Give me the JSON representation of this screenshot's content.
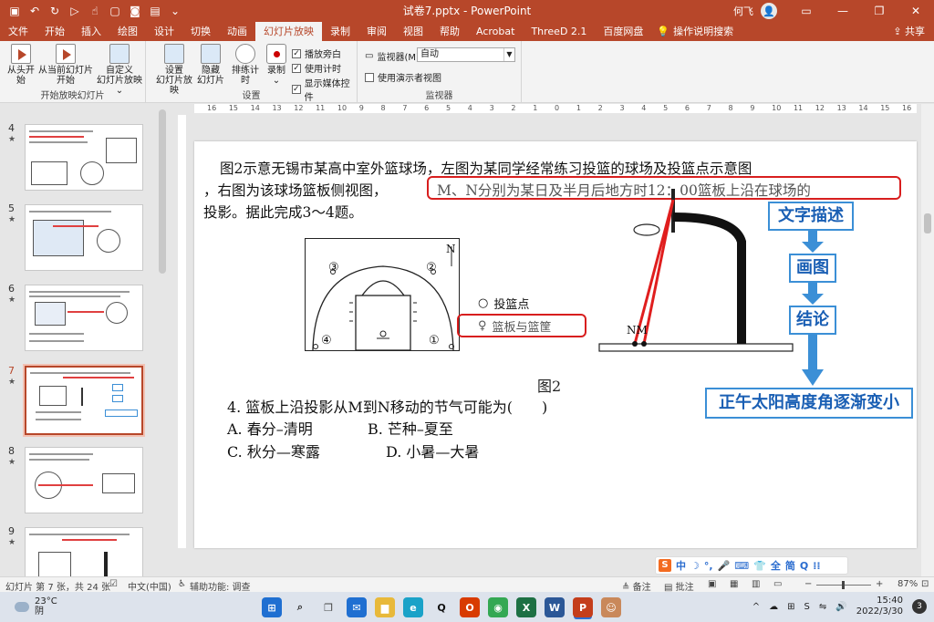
{
  "window": {
    "title": "试卷7.pptx - PowerPoint",
    "user": "何飞",
    "avatar": "👤"
  },
  "tabs": [
    {
      "label": "文件"
    },
    {
      "label": "开始"
    },
    {
      "label": "插入"
    },
    {
      "label": "绘图"
    },
    {
      "label": "设计"
    },
    {
      "label": "切换"
    },
    {
      "label": "动画"
    },
    {
      "label": "幻灯片放映"
    },
    {
      "label": "录制"
    },
    {
      "label": "审阅"
    },
    {
      "label": "视图"
    },
    {
      "label": "帮助"
    },
    {
      "label": "Acrobat"
    },
    {
      "label": "ThreeD 2.1"
    },
    {
      "label": "百度网盘"
    }
  ],
  "active_tab": "幻灯片放映",
  "tell_me": "操作说明搜索",
  "share": "共享",
  "ribbon": {
    "from_beginning": "从头开始",
    "from_current_1": "从当前幻灯片",
    "from_current_2": "开始",
    "custom_1": "自定义",
    "custom_2": "幻灯片放映 ⌄",
    "group_start": "开始放映幻灯片",
    "setup_1": "设置",
    "setup_2": "幻灯片放映",
    "hide_1": "隐藏",
    "hide_2": "幻灯片",
    "rehearse": "排练计时",
    "record": "录制",
    "record_arrow": "⌄",
    "play_narrations": "播放旁白",
    "use_timings": "使用计时",
    "show_media": "显示媒体控件",
    "group_setup": "设置",
    "monitor_label": "监视器(M):",
    "monitor_value": "自动",
    "presenter_view": "使用演示者视图",
    "group_monitor": "监视器"
  },
  "thumbnails": [
    {
      "num": "4"
    },
    {
      "num": "5"
    },
    {
      "num": "6"
    },
    {
      "num": "7"
    },
    {
      "num": "8"
    },
    {
      "num": "9"
    }
  ],
  "slide": {
    "line1": "图2示意无锡市某高中室外篮球场，左图为某同学经常练习投篮的球场及投篮点示意图",
    "line2a": "，右图为该球场篮板侧视图，",
    "line2b": "M、N分别为某日及半月后地方时12：00篮板上沿在球场的",
    "line3": "投影。据此完成3～4题。",
    "court_marks": [
      "③",
      "②",
      "④",
      "①"
    ],
    "north": "N",
    "legend_point": "投篮点",
    "legend_board": "篮板与篮筐",
    "nm_label": "NM",
    "flow1": "文字描述",
    "flow2": "画图",
    "flow3": "结论",
    "flow4": "正午太阳高度角逐渐变小",
    "fig_label": "图2",
    "question": "4. 篮板上沿投影从M到N移动的节气可能为(　　)",
    "optA": "A. 春分–清明",
    "optB": "B. 芒种–夏至",
    "optC": "C. 秋分—寒露",
    "optD": "D. 小暑—大暑"
  },
  "ruler_ticks": [
    "16",
    "15",
    "14",
    "13",
    "12",
    "11",
    "10",
    "9",
    "8",
    "7",
    "6",
    "5",
    "4",
    "3",
    "2",
    "1",
    "0",
    "1",
    "2",
    "3",
    "4",
    "5",
    "6",
    "7",
    "8",
    "9",
    "10",
    "11",
    "12",
    "13",
    "14",
    "15",
    "16"
  ],
  "statusbar": {
    "slide_info": "幻灯片 第 7 张，共 24 张",
    "language": "中文(中国)",
    "accessibility": "辅助功能: 调查",
    "notes": "备注",
    "comments": "批注",
    "zoom": "87%"
  },
  "ime": {
    "items": [
      "中",
      "☽",
      "°,",
      "🎤",
      "⌨",
      "👕",
      "全",
      "简",
      "Q",
      "⁞⁞"
    ]
  },
  "taskbar": {
    "temp": "23°C",
    "weather": "阴",
    "time": "15:40",
    "date": "2022/3/30",
    "notif_count": "3",
    "apps": [
      {
        "name": "start",
        "glyph": "⊞",
        "color": "#1f6fd1"
      },
      {
        "name": "search",
        "glyph": "⌕",
        "color": "#333333"
      },
      {
        "name": "taskview",
        "glyph": "❐",
        "color": "#444444"
      },
      {
        "name": "mail",
        "glyph": "✉",
        "color": "#1f6fd1"
      },
      {
        "name": "explorer",
        "glyph": "▆",
        "color": "#e8b93a"
      },
      {
        "name": "edge",
        "glyph": "e",
        "color": "#1aa2c8"
      },
      {
        "name": "qq",
        "glyph": "Q",
        "color": "#111111"
      },
      {
        "name": "office",
        "glyph": "O",
        "color": "#d83b01"
      },
      {
        "name": "chrome",
        "glyph": "◉",
        "color": "#34a853"
      },
      {
        "name": "excel",
        "glyph": "X",
        "color": "#1d7044"
      },
      {
        "name": "word",
        "glyph": "W",
        "color": "#2b5797"
      },
      {
        "name": "powerpoint",
        "glyph": "P",
        "color": "#c43e1c"
      },
      {
        "name": "avatar-app",
        "glyph": "☺",
        "color": "#c9885a"
      }
    ],
    "tray": [
      "^",
      "☁",
      "⊞",
      "S",
      "⇋",
      "🔊"
    ]
  }
}
